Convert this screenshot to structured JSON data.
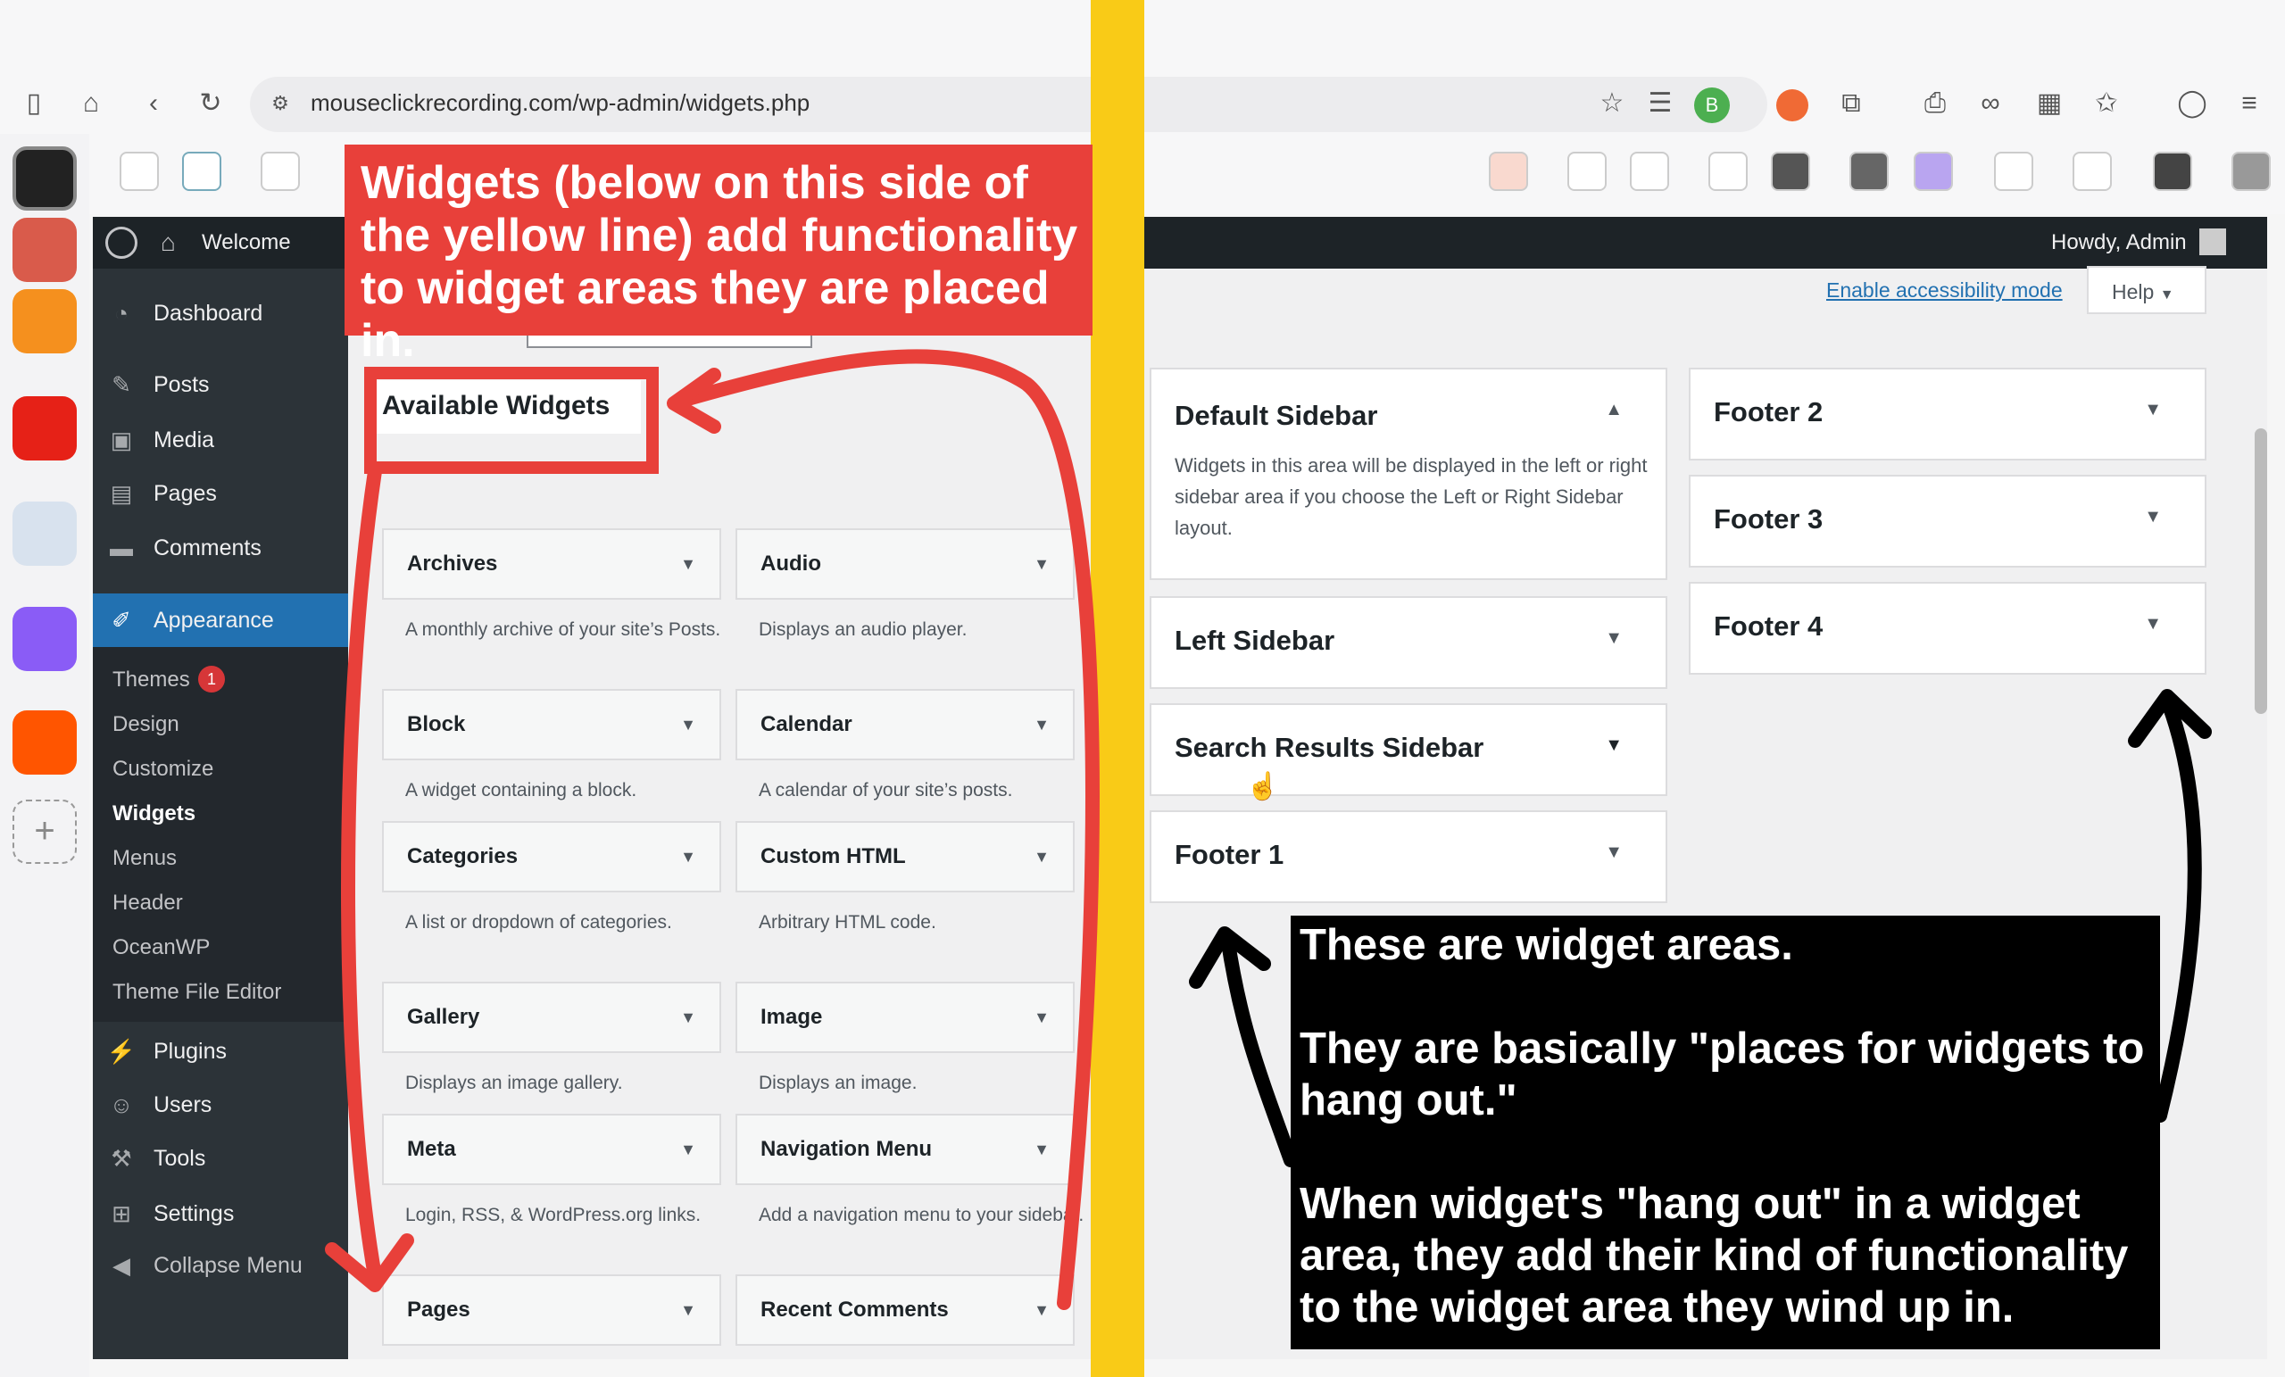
{
  "browser": {
    "url": "mouseclickrecording.com/wp-admin/widgets.php",
    "profile_initial": "B"
  },
  "wp": {
    "site_link": "Welcome",
    "howdy": "Howdy, Admin",
    "accessibility_link": "Enable accessibility mode",
    "help_label": "Help",
    "menu": [
      {
        "label": "Dashboard",
        "icon": "dashboard-icon"
      },
      {
        "label": "Posts",
        "icon": "pin-icon"
      },
      {
        "label": "Media",
        "icon": "media-icon"
      },
      {
        "label": "Pages",
        "icon": "pages-icon"
      },
      {
        "label": "Comments",
        "icon": "comment-icon"
      },
      {
        "label": "Appearance",
        "icon": "brush-icon"
      },
      {
        "label": "Plugins",
        "icon": "plug-icon"
      },
      {
        "label": "Users",
        "icon": "user-icon"
      },
      {
        "label": "Tools",
        "icon": "wrench-icon"
      },
      {
        "label": "Settings",
        "icon": "settings-icon"
      },
      {
        "label": "Collapse Menu",
        "icon": "collapse-icon"
      }
    ],
    "appearance_sub": [
      "Themes",
      "Design",
      "Customize",
      "Widgets",
      "Menus",
      "Header",
      "OceanWP",
      "Theme File Editor"
    ],
    "themes_badge": "1",
    "available_widgets_title": "Available Widgets",
    "widgets": [
      {
        "title": "Archives",
        "desc": "A monthly archive of your site’s Posts."
      },
      {
        "title": "Audio",
        "desc": "Displays an audio player."
      },
      {
        "title": "Block",
        "desc": "A widget containing a block."
      },
      {
        "title": "Calendar",
        "desc": "A calendar of your site’s posts."
      },
      {
        "title": "Categories",
        "desc": "A list or dropdown of categories."
      },
      {
        "title": "Custom HTML",
        "desc": "Arbitrary HTML code."
      },
      {
        "title": "Gallery",
        "desc": "Displays an image gallery."
      },
      {
        "title": "Image",
        "desc": "Displays an image."
      },
      {
        "title": "Meta",
        "desc": "Login, RSS, & WordPress.org links."
      },
      {
        "title": "Navigation Menu",
        "desc": "Add a navigation menu to your sidebar."
      },
      {
        "title": "Pages",
        "desc": ""
      },
      {
        "title": "Recent Comments",
        "desc": ""
      }
    ],
    "areas": {
      "default_sidebar": {
        "title": "Default Sidebar",
        "desc": "Widgets in this area will be displayed in the left or right sidebar area if you choose the Left or Right Sidebar layout."
      },
      "left_sidebar": "Left Sidebar",
      "search_sidebar": "Search Results Sidebar",
      "footer1": "Footer 1",
      "footer2": "Footer 2",
      "footer3": "Footer 3",
      "footer4": "Footer 4"
    }
  },
  "annotations": {
    "red_note": "Widgets (below on this side of the yellow line) add functionality to widget areas they are placed in.",
    "black_note": "These are widget areas.\n\nThey are basically \"places for widgets to hang out.\"\n\nWhen widget's \"hang out\" in a widget area, they add their kind of functionality to the widget area they wind up in.",
    "colors": {
      "red": "#e8403a",
      "yellow": "#f9cb17",
      "black": "#000000",
      "wp_blue": "#2271b1"
    }
  }
}
